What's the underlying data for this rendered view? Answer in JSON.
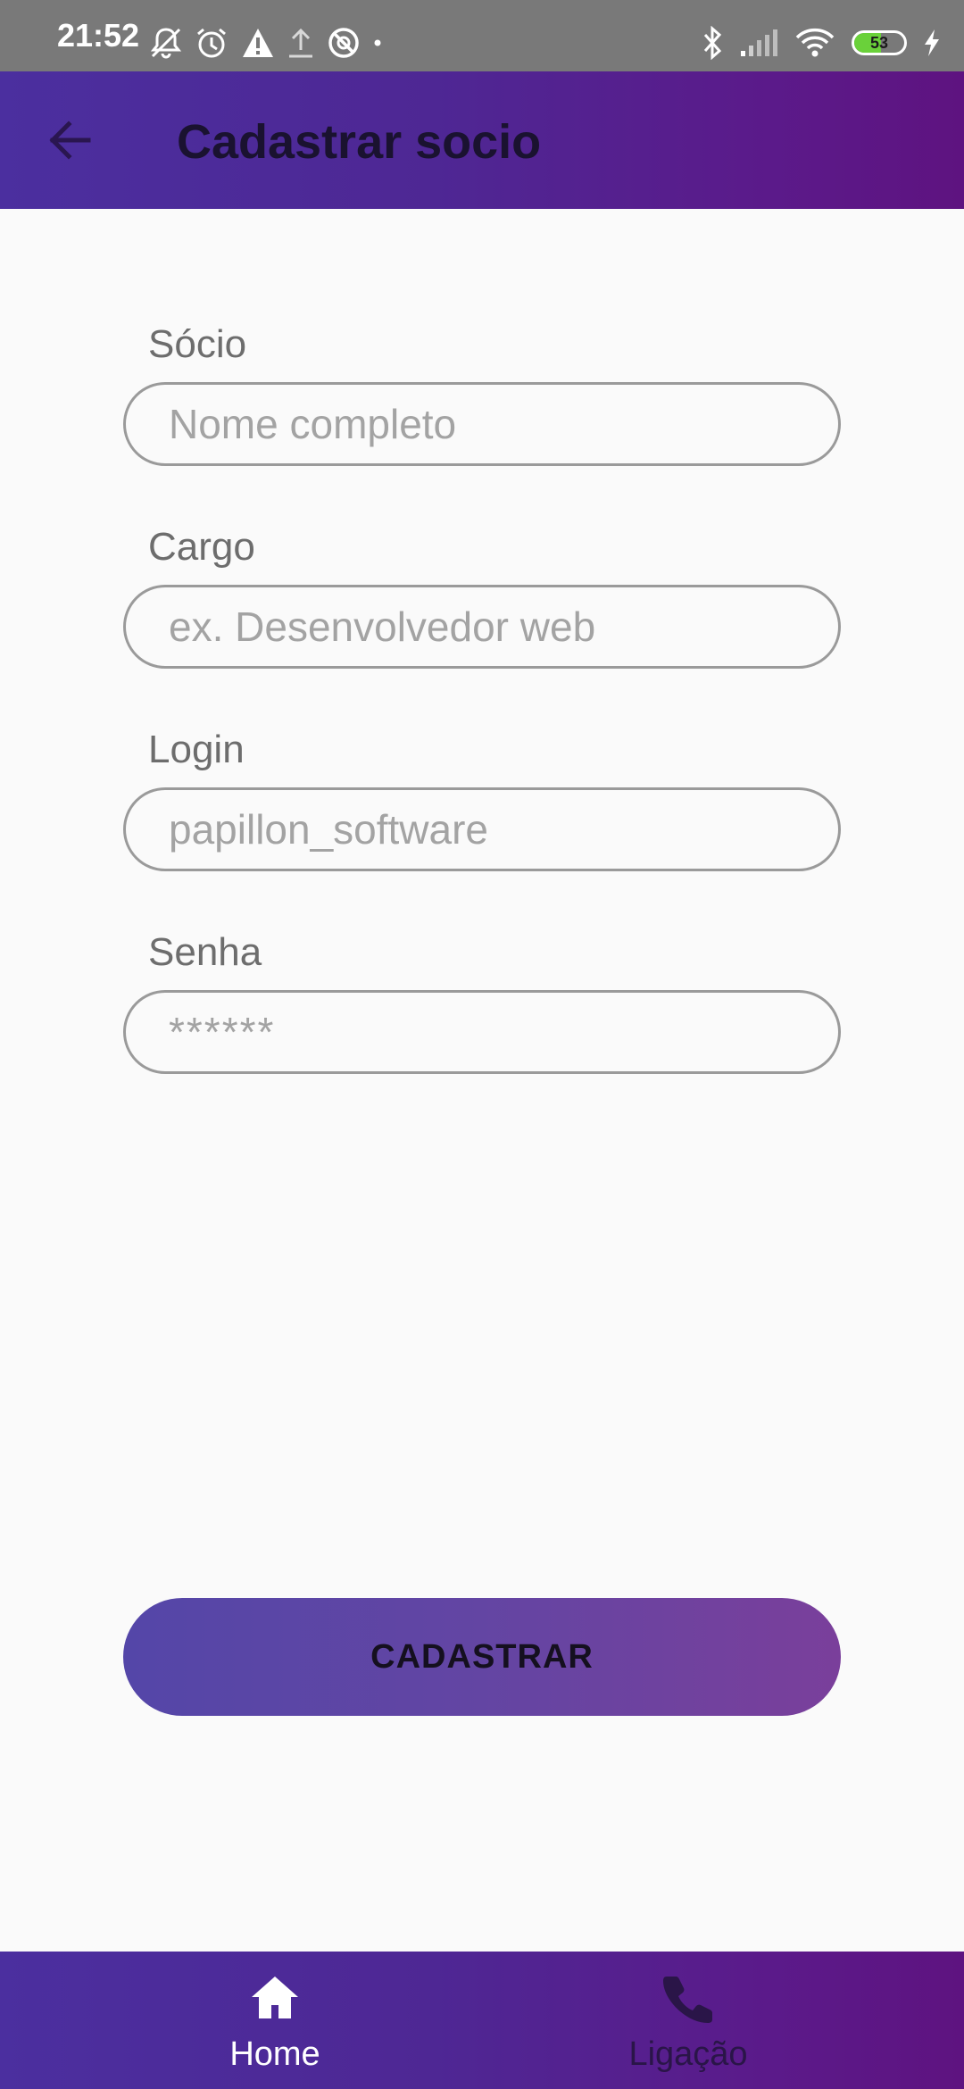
{
  "status_bar": {
    "time": "21:52",
    "left_icons": [
      "bell-off-icon",
      "alarm-icon",
      "warning-icon",
      "upload-icon",
      "blocked-icon",
      "dot-icon"
    ],
    "right_icons": [
      "bluetooth-icon",
      "signal-icon",
      "wifi-icon",
      "battery-icon",
      "charging-icon"
    ],
    "battery_level": "53",
    "battery_color": "#6ad13a"
  },
  "app_bar": {
    "title": "Cadastrar socio",
    "back_icon": "arrow-back-icon",
    "gradient_start": "#4b2f9f",
    "gradient_end": "#5e1380"
  },
  "form": {
    "fields": [
      {
        "label": "Sócio",
        "placeholder": "Nome completo",
        "value": ""
      },
      {
        "label": "Cargo",
        "placeholder": "ex. Desenvolvedor web",
        "value": ""
      },
      {
        "label": "Login",
        "placeholder": "papillon_software",
        "value": ""
      },
      {
        "label": "Senha",
        "placeholder": "******",
        "value": ""
      }
    ],
    "submit_label": "CADASTRAR"
  },
  "bottom_nav": {
    "items": [
      {
        "label": "Home",
        "icon": "home-icon",
        "active": true
      },
      {
        "label": "Ligação",
        "icon": "phone-icon",
        "active": false
      }
    ]
  }
}
